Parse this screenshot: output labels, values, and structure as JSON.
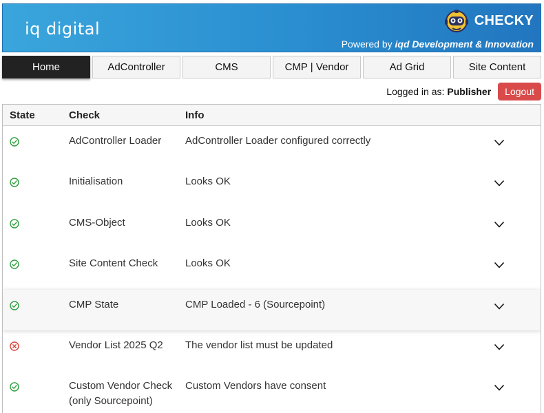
{
  "header": {
    "logo_text": "iq digital",
    "app_name": "CHECKY",
    "powered_prefix": "Powered by",
    "powered_by": "iqd Development & Innovation",
    "background_color": "#2a8ed0"
  },
  "nav": {
    "tabs": [
      {
        "label": "Home",
        "active": true
      },
      {
        "label": "AdController",
        "active": false
      },
      {
        "label": "CMS",
        "active": false
      },
      {
        "label": "CMP | Vendor",
        "active": false
      },
      {
        "label": "Ad Grid",
        "active": false
      },
      {
        "label": "Site Content",
        "active": false
      }
    ]
  },
  "session": {
    "logged_in_label": "Logged in as:",
    "user": "Publisher",
    "logout_label": "Logout",
    "logout_color": "#d94a4a"
  },
  "table": {
    "headers": {
      "state": "State",
      "check": "Check",
      "info": "Info"
    },
    "rows": [
      {
        "state": "ok",
        "check": "AdController Loader",
        "info": "AdController Loader configured correctly"
      },
      {
        "state": "ok",
        "check": "Initialisation",
        "info": "Looks OK"
      },
      {
        "state": "ok",
        "check": "CMS-Object",
        "info": "Looks OK"
      },
      {
        "state": "ok",
        "check": "Site Content Check",
        "info": "Looks OK"
      },
      {
        "state": "ok",
        "check": "CMP State",
        "info": "CMP Loaded - 6 (Sourcepoint)"
      },
      {
        "state": "error",
        "check": "Vendor List 2025 Q2",
        "info": "The vendor list must be updated"
      },
      {
        "state": "ok",
        "check": "Custom Vendor Check (only Sourcepoint)",
        "info": "Custom Vendors have consent"
      }
    ],
    "status_colors": {
      "ok": "#2e9e3e",
      "error": "#d9433a"
    },
    "expand_icon": "chevron-down-icon"
  }
}
